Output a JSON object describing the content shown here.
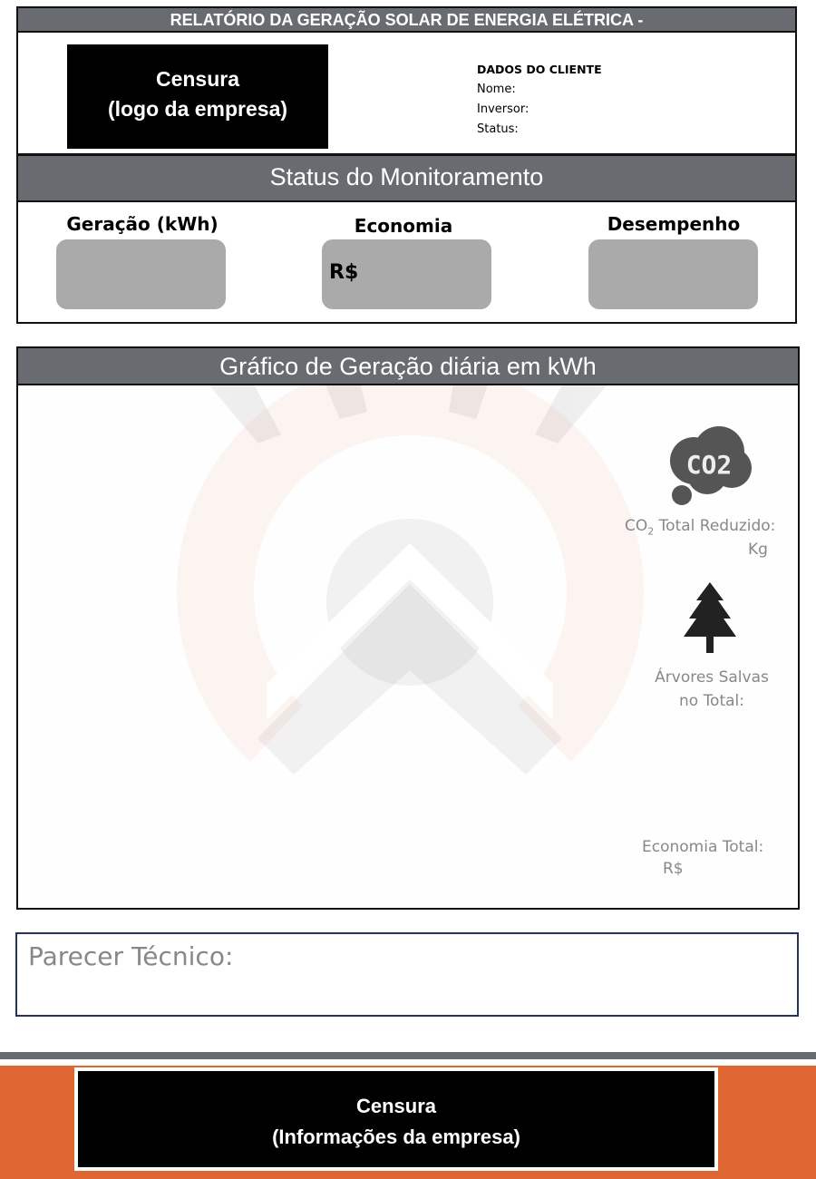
{
  "title": "RELATÓRIO DA GERAÇÃO SOLAR DE ENERGIA ELÉTRICA -",
  "logo": {
    "line1": "Censura",
    "line2": "(logo da empresa)"
  },
  "client": {
    "heading": "DADOS DO CLIENTE",
    "name_label": "Nome:",
    "inverter_label": "Inversor:",
    "status_label": "Status:"
  },
  "status": {
    "title": "Status do Monitoramento",
    "generation_label": "Geração (kWh)",
    "savings_label": "Economia",
    "savings_value": "R$",
    "performance_label": "Desempenho"
  },
  "chart": {
    "title": "Gráfico de Geração diária em kWh"
  },
  "sidebar": {
    "co2_icon_text": "CO2",
    "co2_label_prefix": "CO",
    "co2_sub": "2",
    "co2_label_suffix": " Total Reduzido:",
    "co2_unit": "Kg",
    "trees_label_1": "Árvores Salvas",
    "trees_label_2": "no Total:",
    "savings_total_label": "Economia Total:",
    "savings_total_value": "R$"
  },
  "parecer": {
    "label": "Parecer Técnico:"
  },
  "footer": {
    "line1": "Censura",
    "line2": "(Informações da empresa)"
  },
  "colors": {
    "header_gray": "#686c70",
    "accent_orange": "#dd6633",
    "card_gray": "#aaaaaa"
  }
}
